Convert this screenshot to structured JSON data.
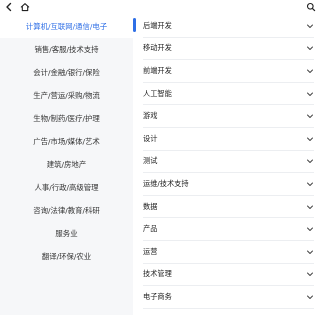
{
  "header": {
    "back_icon": "chevron-left-icon",
    "home_icon": "home-icon",
    "search_icon": "search-icon"
  },
  "categories": [
    {
      "label": "计算机/互联网/通信/电子",
      "active": true
    },
    {
      "label": "销售/客服/技术支持"
    },
    {
      "label": "会计/金融/银行/保险"
    },
    {
      "label": "生产/营运/采购/物流"
    },
    {
      "label": "生物/制药/医疗/护理"
    },
    {
      "label": "广告/市场/媒体/艺术"
    },
    {
      "label": "建筑/房地产"
    },
    {
      "label": "人事/行政/高级管理"
    },
    {
      "label": "咨询/法律/教育/科研"
    },
    {
      "label": "服务业"
    },
    {
      "label": "翻译/环保/农业"
    }
  ],
  "subcategories": [
    {
      "label": "后端开发"
    },
    {
      "label": "移动开发"
    },
    {
      "label": "前端开发"
    },
    {
      "label": "人工智能"
    },
    {
      "label": "游戏"
    },
    {
      "label": "设计"
    },
    {
      "label": "测试"
    },
    {
      "label": "运维/技术支持"
    },
    {
      "label": "数据"
    },
    {
      "label": "产品"
    },
    {
      "label": "运营"
    },
    {
      "label": "技术管理"
    },
    {
      "label": "电子商务"
    }
  ],
  "colors": {
    "accent": "#2f6fe6",
    "left_bg": "#f6f7f9"
  }
}
